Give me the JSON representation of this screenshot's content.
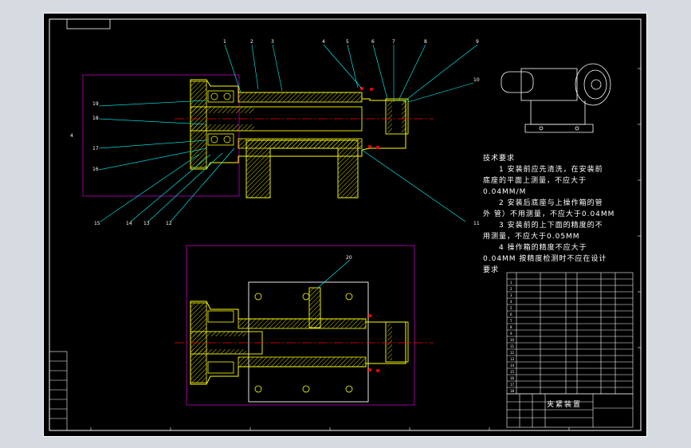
{
  "drawing": {
    "callouts_top": [
      "1",
      "2",
      "3",
      "4",
      "5",
      "6",
      "7",
      "8",
      "9",
      "10"
    ],
    "callouts_left": [
      "19",
      "18",
      "17",
      "16"
    ],
    "callouts_bottom": [
      "15",
      "14",
      "13",
      "12"
    ],
    "callout_right": "11",
    "callout_section": "20",
    "dim_left": "4"
  },
  "requirements": {
    "title": "技术要求",
    "lines": [
      "1 安装前应先清洗，在安装前",
      "底座的平面上测量，不应大于",
      "0.04MM/M",
      "2 安装后底座与上操作箱的管",
      "外 管）不用测量，不应大于0.04MM",
      "3 安装前的上下面的精度的不",
      "用测量，不应大于0.05MM",
      "4 操作箱的精度不应大于",
      "0.04MM 按精度检测时不应在设计",
      "要求"
    ]
  },
  "title_block": {
    "name": "夹紧装置"
  },
  "colors": {
    "background": "#000000",
    "frame": "#ffffff",
    "part": "#ffff00",
    "leader": "#00ffff",
    "center": "#ff0000",
    "dimension": "#ff00ff",
    "text": "#ffffff"
  }
}
